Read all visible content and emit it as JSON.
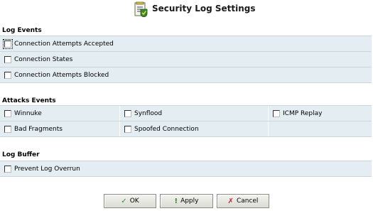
{
  "page": {
    "title": "Security Log Settings"
  },
  "log_events": {
    "heading": "Log Events",
    "items": [
      {
        "label": "Connection Attempts Accepted",
        "checked": false
      },
      {
        "label": "Connection States",
        "checked": false
      },
      {
        "label": "Connection Attempts Blocked",
        "checked": false
      }
    ]
  },
  "attacks_events": {
    "heading": "Attacks Events",
    "rows": [
      [
        {
          "label": "Winnuke",
          "checked": false
        },
        {
          "label": "Synflood",
          "checked": false
        },
        {
          "label": "ICMP Replay",
          "checked": false
        }
      ],
      [
        {
          "label": "Bad Fragments",
          "checked": false
        },
        {
          "label": "Spoofed Connection",
          "checked": false
        }
      ]
    ]
  },
  "log_buffer": {
    "heading": "Log Buffer",
    "items": [
      {
        "label": "Prevent Log Overrun",
        "checked": false
      }
    ]
  },
  "buttons": {
    "ok": {
      "label": "OK",
      "icon": "check-icon",
      "color": "#2e8b2e"
    },
    "apply": {
      "label": "Apply",
      "icon": "exclamation-icon",
      "color": "#2e8b2e"
    },
    "cancel": {
      "label": "Cancel",
      "icon": "x-icon",
      "color": "#c0202a"
    }
  }
}
